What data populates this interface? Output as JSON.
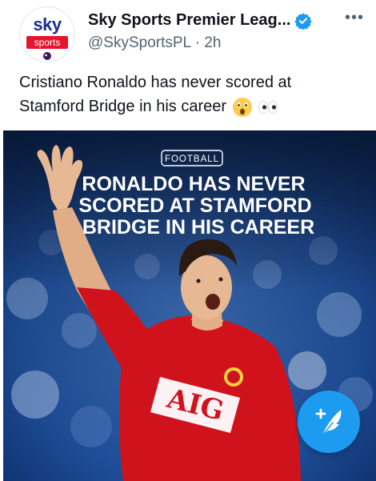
{
  "author": {
    "name": "Sky Sports Premier Leag...",
    "handle": "@SkySportsPL",
    "time_separator": "·",
    "timestamp": "2h",
    "avatar_logo_top": "sky",
    "avatar_logo_bottom": "sports",
    "verified_icon": "verified-badge-icon"
  },
  "menu": {
    "label": "•••"
  },
  "tweet": {
    "text_line1": "Cristiano Ronaldo has never scored at",
    "text_line2": "Stamford Bridge in his career",
    "emojis": [
      "astonished-face-emoji",
      "eyes-emoji"
    ]
  },
  "media": {
    "tag": "FOOTBALL",
    "headline_line1": "RONALDO HAS NEVER",
    "headline_line2": "SCORED AT STAMFORD",
    "headline_line3": "BRIDGE IN HIS CAREER",
    "shirt_sponsor": "AIG"
  },
  "compose": {
    "icon": "compose-tweet-icon"
  },
  "colors": {
    "accent": "#1d9bf0",
    "handle_gray": "#536471",
    "shirt_red": "#d0121c",
    "sky_blue": "#1c2f8f",
    "sky_red": "#e5162b"
  }
}
